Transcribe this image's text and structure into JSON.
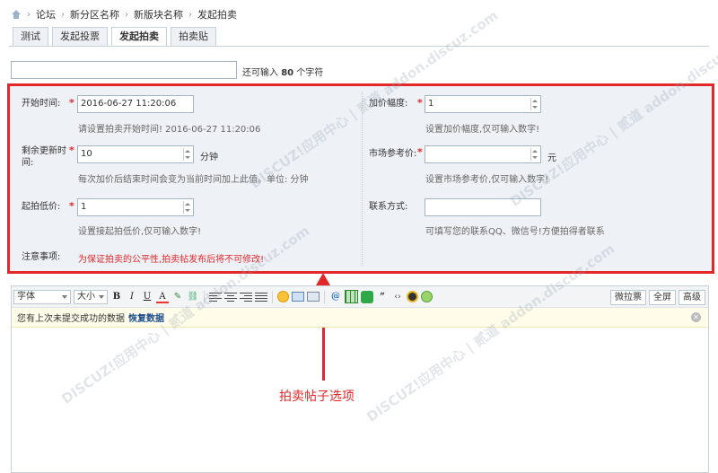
{
  "breadcrumb": {
    "items": [
      "论坛",
      "新分区名称",
      "新版块名称",
      "发起拍卖"
    ],
    "sep": "›"
  },
  "tabs": [
    "测试",
    "发起投票",
    "发起拍卖",
    "拍卖贴"
  ],
  "title_hint": {
    "prefix": "还可输入",
    "count": "80",
    "suffix": "个字符"
  },
  "form": {
    "start_time": {
      "label": "开始时间:",
      "value": "2016-06-27 11:20:06",
      "hint": "请设置拍卖开始时间!  2016-06-27 11:20:06"
    },
    "remaining": {
      "label_1": "剩余更新时",
      "label_2": "间:",
      "value": "10",
      "unit": "分钟",
      "hint": "每次加价后结束时间会变为当前时间加上此值。单位: 分钟"
    },
    "start_price": {
      "label": "起拍低价:",
      "value": "1",
      "hint": "设置接起拍低价,仅可输入数字!"
    },
    "notice": {
      "label": "注意事项:",
      "text": "为保证拍卖的公平性,拍卖帖发布后将不可修改!"
    },
    "increment": {
      "label": "加价幅度:",
      "value": "1",
      "hint": "设置加价幅度,仅可输入数字!"
    },
    "reference": {
      "label": "市场参考价:",
      "value": "",
      "unit": "元",
      "hint": "设置市场参考价,仅可输入数字!"
    },
    "contact": {
      "label": "联系方式:",
      "value": "",
      "hint": "可填写您的联系QQ、微信号!方便拍得者联系"
    },
    "required_mark": "*"
  },
  "editor": {
    "font_label": "字体",
    "size_label": "大小",
    "bold": "B",
    "italic": "I",
    "underline": "U",
    "color": "A",
    "quote": "“",
    "right_buttons": [
      "微拉票",
      "全屏",
      "高级"
    ],
    "restore_text": "您有上次未提交成功的数据",
    "restore_link": "恢复数据"
  },
  "annotation": "拍卖帖子选项",
  "watermark": "DISCUZ!应用中心 | 贰道 addon.discuz.com"
}
